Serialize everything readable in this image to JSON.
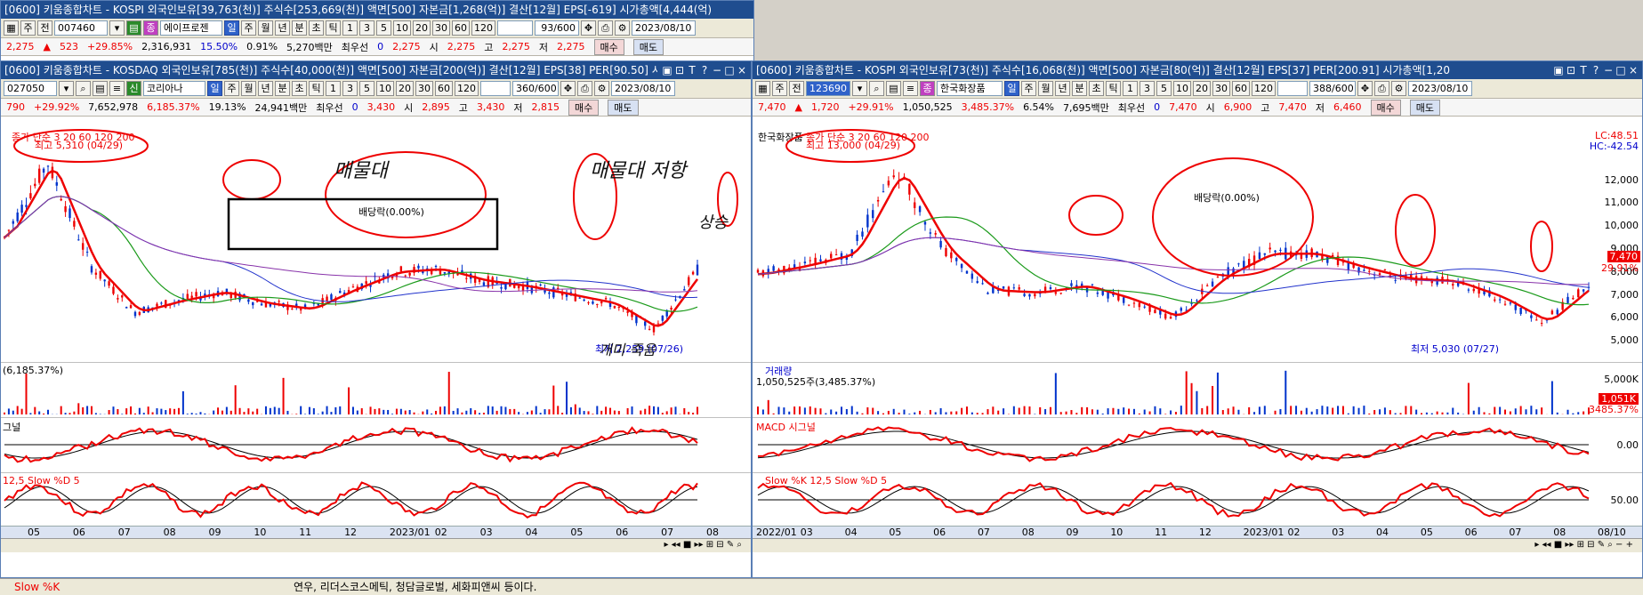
{
  "back": {
    "title": "[0600] 키움종합차트 - KOSPI 외국인보유[39,763(천)] 주식수[253,669(천)] 액면[500] 자본금[1,268(억)] 결산[12월] EPS[-619] 시가총액[4,444(억)",
    "code": "007460",
    "name": "에이프로젠",
    "count": "93/600",
    "date": "2023/08/10",
    "quote": {
      "price": "2,275",
      "change": "523",
      "rate": "+29.85%",
      "volume": "2,316,931",
      "turnover": "15.50%",
      "ratio": "0.91%",
      "amount": "5,270백만",
      "label_best": "최우선",
      "best_qty": "0",
      "best_price": "2,275",
      "o_label": "시",
      "o": "2,275",
      "h_label": "고",
      "h": "2,275",
      "l_label": "저",
      "l": "2,275"
    }
  },
  "common": {
    "period_tabs": [
      "일",
      "주",
      "월",
      "년",
      "분",
      "초",
      "틱"
    ],
    "numbers": [
      "1",
      "3",
      "5",
      "10",
      "20",
      "30",
      "60",
      "120"
    ],
    "buy": "매수",
    "sell": "매도",
    "label_ju": "주",
    "label_jeon": "전",
    "label_sin": "신",
    "label_jung": "종",
    "label_bestpri": "최우선",
    "window_buttons": [
      "▣",
      "⊡",
      "T",
      "?",
      "−",
      "□",
      "×"
    ]
  },
  "left": {
    "title": "[0600] 키움종합차트 - KOSDAQ 외국인보유[785(천)] 주식수[40,000(천)] 액면[500] 자본금[200(억)] 결산[12월] EPS[38] PER[90.50] 시가총액[1,3",
    "code": "027050",
    "name": "코리아나",
    "count": "360/600",
    "date": "2023/08/10",
    "quote": {
      "change": "790",
      "rate": "+29.92%",
      "volume": "7,652,978",
      "turnover": "6,185.37%",
      "ratio": "19.13%",
      "amount": "24,941백만",
      "best_qty": "0",
      "best_price": "3,430",
      "o_label": "시",
      "o": "2,895",
      "h_label": "고",
      "h": "3,430",
      "l_label": "저",
      "l": "2,815"
    },
    "legend": "종가 단순 3  20  60  120  200",
    "high": "최고 5,310 (04/29)",
    "low": "최저 2,259 (07/26)",
    "dividend": "배당락(0.00%)",
    "volume_label": "(6,185.37%)",
    "macd_label": "그널",
    "stoch_label": "12,5  Slow %D 5",
    "months": [
      "05",
      "06",
      "07",
      "08",
      "09",
      "10",
      "11",
      "12",
      "2023/01",
      "02",
      "03",
      "04",
      "05",
      "06",
      "07",
      "08"
    ],
    "annotations": [
      "매물대",
      "매물대 저항",
      "상승",
      "개미 죽음"
    ],
    "chart_data": {
      "type": "line",
      "x": [
        "2022/04",
        "2022/05",
        "2022/06",
        "2022/07",
        "2022/08",
        "2022/09",
        "2022/10",
        "2022/11",
        "2022/12",
        "2023/01",
        "2023/02",
        "2023/03",
        "2023/04",
        "2023/05",
        "2023/06",
        "2023/07",
        "2023/08"
      ],
      "series": [
        {
          "name": "종가",
          "values": [
            4000,
            5310,
            3500,
            2700,
            2900,
            3050,
            2850,
            2750,
            3100,
            3400,
            3450,
            3250,
            3150,
            3000,
            2850,
            2400,
            3430
          ]
        }
      ],
      "ylim": [
        2000,
        5600
      ]
    }
  },
  "right": {
    "title": "[0600] 키움종합차트 - KOSPI 외국인보유[73(천)] 주식수[16,068(천)] 액면[500] 자본금[80(억)] 결산[12월] EPS[37] PER[200.91] 시가총액[1,20",
    "code": "123690",
    "name": "한국화장품",
    "count": "388/600",
    "date": "2023/08/10",
    "quote": {
      "price": "7,470",
      "change": "1,720",
      "rate": "+29.91%",
      "volume": "1,050,525",
      "turnover": "3,485.37%",
      "ratio": "6.54%",
      "amount": "7,695백만",
      "best_qty": "0",
      "best_price": "7,470",
      "o_label": "시",
      "o": "6,900",
      "h_label": "고",
      "h": "7,470",
      "l_label": "저",
      "l": "6,460"
    },
    "legend_name": "한국화장품",
    "legend": "종가 단순 3  20  60  120  200",
    "high": "최고 13,000 (04/29)",
    "low": "최저 5,030 (07/27)",
    "dividend": "배당락(0.00%)",
    "lc": "LC:48.51",
    "hc": "HC:-42.54",
    "y_ticks": [
      "12,000",
      "11,000",
      "10,000",
      "9,000",
      "8,000",
      "7,000",
      "6,000",
      "5,000"
    ],
    "price_tag": "7,470",
    "pct_tag": "29.91%",
    "volume_title": "거래량",
    "volume_label": "1,050,525주(3,485.37%)",
    "volume_scale": "5,000K",
    "volume_tag": "1,051K",
    "volume_pct": "3485.37%",
    "macd_label": "MACD  시그널",
    "macd_zero": "0.00",
    "stoch_label": "Slow %K 12,5  Slow %D 5",
    "stoch_mid": "50.00",
    "months": [
      "2022/01",
      "03",
      "04",
      "05",
      "06",
      "07",
      "08",
      "09",
      "10",
      "11",
      "12",
      "2023/01",
      "02",
      "03",
      "04",
      "05",
      "06",
      "07",
      "08",
      "08/10"
    ],
    "chart_data": {
      "type": "line",
      "x": [
        "2022/02",
        "2022/03",
        "2022/04",
        "2022/05",
        "2022/06",
        "2022/07",
        "2022/08",
        "2022/09",
        "2022/10",
        "2022/11",
        "2022/12",
        "2023/01",
        "2023/02",
        "2023/03",
        "2023/04",
        "2023/05",
        "2023/06",
        "2023/07",
        "2023/08"
      ],
      "series": [
        {
          "name": "종가",
          "values": [
            7900,
            8300,
            8800,
            12500,
            9000,
            7200,
            7100,
            7400,
            6800,
            6000,
            7800,
            8800,
            8800,
            8200,
            7700,
            7600,
            6900,
            5800,
            7470
          ]
        }
      ],
      "ylim": [
        4500,
        13500
      ]
    }
  },
  "bottom": {
    "tab": "Slow %K",
    "news": "연우, 리더스코스메틱, 청담글로벌, 세화피앤씨 등이다."
  }
}
